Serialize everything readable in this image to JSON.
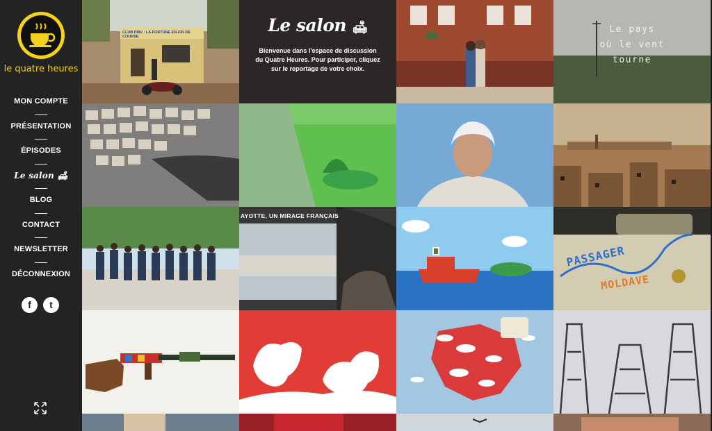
{
  "brand": {
    "name": "le quatre heures"
  },
  "nav": [
    {
      "label": "MON COMPTE"
    },
    {
      "label": "PRÉSENTATION"
    },
    {
      "label": "ÉPISODES"
    },
    {
      "label": "Le salon"
    },
    {
      "label": "BLOG"
    },
    {
      "label": "CONTACT"
    },
    {
      "label": "NEWSLETTER"
    },
    {
      "label": "DÉCONNEXION"
    }
  ],
  "social": {
    "facebook": "f",
    "twitter": "t"
  },
  "intro": {
    "title": "Le salon",
    "text": "Bienvenue dans l'espace de discussion du Quatre Heures. Pour participer, cliquez sur le reportage de votre choix."
  },
  "tiles": {
    "club_sign": "CLUB PMU : LA FORTUNE EN FIN DE COURSE",
    "pays_line1": "Le pays",
    "pays_line2": "où le vent",
    "pays_line3": "tourne",
    "mayotte": "AYOTTE, UN MIRAGE FRANÇAIS",
    "passager": "PASSAGER",
    "moldave": "MOLDAVE"
  },
  "colors": {
    "accent": "#f5d21a",
    "sidebar": "#232323",
    "intro_bg": "#2b2726"
  }
}
